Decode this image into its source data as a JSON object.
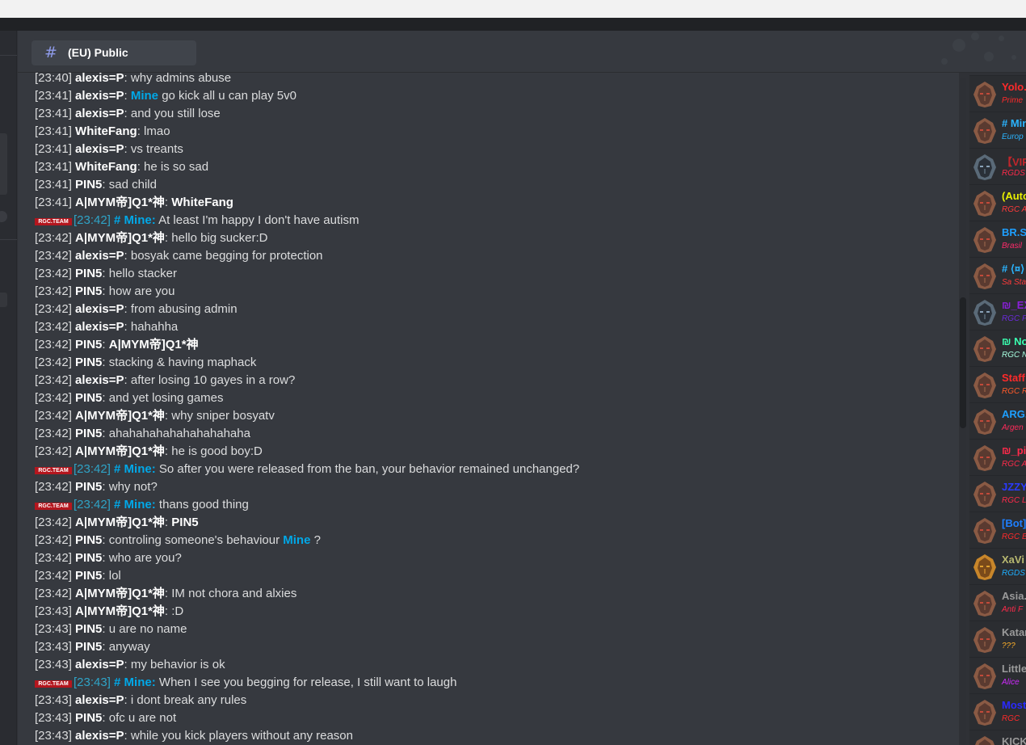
{
  "channel": {
    "hash": "#",
    "name": "(EU) Public"
  },
  "badge_text": "RGC.TEAM",
  "messages": [
    {
      "type": "normal",
      "ts": "[23:40]",
      "user": "alexis=P",
      "text": "why admins abuse"
    },
    {
      "type": "mention",
      "ts": "[23:41]",
      "user": "alexis=P",
      "mention": "Mine",
      "text": "go kick all u can play 5v0"
    },
    {
      "type": "normal",
      "ts": "[23:41]",
      "user": "alexis=P",
      "text": "and you still lose"
    },
    {
      "type": "normal",
      "ts": "[23:41]",
      "user": "WhiteFang",
      "text": "lmao"
    },
    {
      "type": "normal",
      "ts": "[23:41]",
      "user": "alexis=P",
      "text": "vs treants"
    },
    {
      "type": "normal",
      "ts": "[23:41]",
      "user": "WhiteFang",
      "text": "he is so sad"
    },
    {
      "type": "normal",
      "ts": "[23:41]",
      "user": "PIN5",
      "text": "sad child"
    },
    {
      "type": "bold",
      "ts": "[23:41]",
      "user": "A|MYM帝]Q1*神",
      "text": "WhiteFang"
    },
    {
      "type": "team",
      "ts": "[23:42]",
      "user": "# Mine:",
      "text": "At least I'm happy I don't have autism"
    },
    {
      "type": "normal",
      "ts": "[23:42]",
      "user": "A|MYM帝]Q1*神",
      "text": "hello big sucker:D"
    },
    {
      "type": "normal",
      "ts": "[23:42]",
      "user": "alexis=P",
      "text": "bosyak came begging for protection"
    },
    {
      "type": "normal",
      "ts": "[23:42]",
      "user": "PIN5",
      "text": "hello stacker"
    },
    {
      "type": "normal",
      "ts": "[23:42]",
      "user": "PIN5",
      "text": "how are you"
    },
    {
      "type": "normal",
      "ts": "[23:42]",
      "user": "alexis=P",
      "text": "from abusing admin"
    },
    {
      "type": "normal",
      "ts": "[23:42]",
      "user": "alexis=P",
      "text": "hahahha"
    },
    {
      "type": "bold",
      "ts": "[23:42]",
      "user": "PIN5",
      "text": "A|MYM帝]Q1*神"
    },
    {
      "type": "normal",
      "ts": "[23:42]",
      "user": "PIN5",
      "text": "stacking & having maphack"
    },
    {
      "type": "normal",
      "ts": "[23:42]",
      "user": "alexis=P",
      "text": "after losing 10 gayes in a row?"
    },
    {
      "type": "normal",
      "ts": "[23:42]",
      "user": "PIN5",
      "text": "and yet losing games"
    },
    {
      "type": "normal",
      "ts": "[23:42]",
      "user": "A|MYM帝]Q1*神",
      "text": "why sniper bosyatv"
    },
    {
      "type": "normal",
      "ts": "[23:42]",
      "user": "PIN5",
      "text": "ahahahahahahahahahaha"
    },
    {
      "type": "normal",
      "ts": "[23:42]",
      "user": "A|MYM帝]Q1*神",
      "text": "he is good boy:D"
    },
    {
      "type": "team",
      "ts": "[23:42]",
      "user": "# Mine:",
      "text": "So after you were released from the ban, your behavior remained unchanged?"
    },
    {
      "type": "normal",
      "ts": "[23:42]",
      "user": "PIN5",
      "text": "why not?"
    },
    {
      "type": "team",
      "ts": "[23:42]",
      "user": "# Mine:",
      "text": "thans good thing"
    },
    {
      "type": "bold",
      "ts": "[23:42]",
      "user": "A|MYM帝]Q1*神",
      "text": "PIN5"
    },
    {
      "type": "mention_end",
      "ts": "[23:42]",
      "user": "PIN5",
      "text": "controling someone's behaviour",
      "mention": "Mine",
      "suffix": "?"
    },
    {
      "type": "normal",
      "ts": "[23:42]",
      "user": "PIN5",
      "text": "who are you?"
    },
    {
      "type": "normal",
      "ts": "[23:42]",
      "user": "PIN5",
      "text": "lol"
    },
    {
      "type": "normal",
      "ts": "[23:42]",
      "user": "A|MYM帝]Q1*神",
      "text": "IM not chora and alxies"
    },
    {
      "type": "normal",
      "ts": "[23:43]",
      "user": "A|MYM帝]Q1*神",
      "text": ":D"
    },
    {
      "type": "normal",
      "ts": "[23:43]",
      "user": "PIN5",
      "text": "u are no name"
    },
    {
      "type": "normal",
      "ts": "[23:43]",
      "user": "PIN5",
      "text": "anyway"
    },
    {
      "type": "normal",
      "ts": "[23:43]",
      "user": "alexis=P",
      "text": "my behavior is ok"
    },
    {
      "type": "team",
      "ts": "[23:43]",
      "user": "# Mine:",
      "text": "When I see you begging for release, I still want to laugh"
    },
    {
      "type": "normal",
      "ts": "[23:43]",
      "user": "alexis=P",
      "text": "i dont break any rules"
    },
    {
      "type": "normal",
      "ts": "[23:43]",
      "user": "PIN5",
      "text": "ofc u are not"
    },
    {
      "type": "normal",
      "ts": "[23:43]",
      "user": "alexis=P",
      "text": "while you kick players without any reason"
    }
  ],
  "members": [
    {
      "name": "Yolo.",
      "sub": "Prime",
      "name_color": "#ff2a2a",
      "sub_color": "#ff2a2a",
      "avatar": "bronze"
    },
    {
      "name": "# Min",
      "sub": "Europ",
      "name_color": "#2ab4ff",
      "sub_color": "#2ab4ff",
      "avatar": "bronze"
    },
    {
      "name": "【VIP】",
      "sub": "RGDS",
      "name_color": "#c0262b",
      "sub_color": "#ff2a4a",
      "avatar": "dark"
    },
    {
      "name": "(Auto",
      "sub": "RGC A",
      "name_color": "#e8f000",
      "sub_color": "#ff3a3a",
      "avatar": "bronze"
    },
    {
      "name": "BR.SU",
      "sub": "Brasil",
      "name_color": "#1e9fff",
      "sub_color": "#ff2a6a",
      "avatar": "bronze"
    },
    {
      "name": "# ⟨¤⟩",
      "sub": "Sa Sta",
      "name_color": "#2ab4ff",
      "sub_color": "#ff3a3a",
      "avatar": "bronze"
    },
    {
      "name": "₪_EX",
      "sub": "RGC P",
      "name_color": "#8a1fd8",
      "sub_color": "#6a2ad8",
      "avatar": "dark"
    },
    {
      "name": "₪ No",
      "sub": "RGC N",
      "name_color": "#3affb0",
      "sub_color": "#a8ffe0",
      "avatar": "bronze"
    },
    {
      "name": "Staff",
      "sub": "RGC R",
      "name_color": "#ff2a2a",
      "sub_color": "#ff5a2a",
      "avatar": "bronze"
    },
    {
      "name": "ARG.",
      "sub": "Argen",
      "name_color": "#1e9fff",
      "sub_color": "#ff2a5a",
      "avatar": "bronze"
    },
    {
      "name": "₪_pi",
      "sub": "RGC A",
      "name_color": "#ff2a4a",
      "sub_color": "#ff2a4a",
      "avatar": "bronze"
    },
    {
      "name": "JZZY",
      "sub": "RGC L",
      "name_color": "#2a3aff",
      "sub_color": "#ff2a4a",
      "avatar": "bronze"
    },
    {
      "name": "[Bot]",
      "sub": "RGC B",
      "name_color": "#1e7fff",
      "sub_color": "#ff2a2a",
      "avatar": "bronze"
    },
    {
      "name": "XaVi",
      "sub": "RGDS A",
      "name_color": "#b8b870",
      "sub_color": "#1eafff",
      "avatar": "gold"
    },
    {
      "name": "Asia.",
      "sub": "Anti F",
      "name_color": "#9a9a9a",
      "sub_color": "#ff2a4a",
      "avatar": "bronze"
    },
    {
      "name": "Katar",
      "sub": "???",
      "name_color": "#9a9a9a",
      "sub_color": "#ffb02a",
      "avatar": "bronze"
    },
    {
      "name": "Little",
      "sub": "Alice",
      "name_color": "#9a9a9a",
      "sub_color": "#d02aff",
      "avatar": "bronze"
    },
    {
      "name": "Most",
      "sub": "RGC",
      "name_color": "#2a2aff",
      "sub_color": "#ff2a2a",
      "avatar": "bronze"
    },
    {
      "name": "KICKY",
      "sub": "",
      "name_color": "#9a9a9a",
      "sub_color": "#9a9a9a",
      "avatar": "bronze"
    }
  ]
}
